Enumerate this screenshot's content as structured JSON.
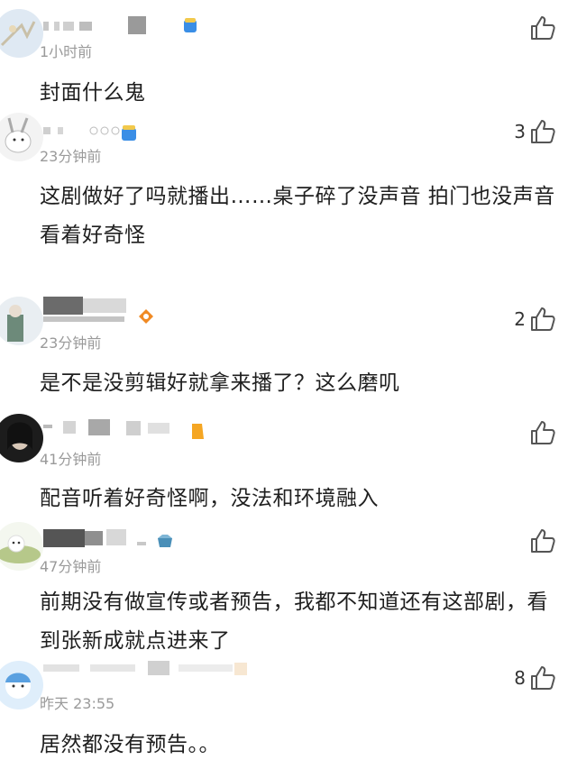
{
  "comments": [
    {
      "time": "1小时前",
      "text": "封面什么鬼",
      "likes": ""
    },
    {
      "time": "23分钟前",
      "text": "这剧做好了吗就播出……桌子碎了没声音 拍门也没声音 看着好奇怪",
      "likes": "3"
    },
    {
      "time": "23分钟前",
      "text": "是不是没剪辑好就拿来播了？这么磨叽",
      "likes": "2"
    },
    {
      "time": "41分钟前",
      "text": "配音听着好奇怪啊，没法和环境融入",
      "likes": ""
    },
    {
      "time": "47分钟前",
      "text": "前期没有做宣传或者预告，我都不知道还有这部剧，看到张新成就点进来了",
      "likes": ""
    },
    {
      "time": "昨天 23:55",
      "text": "居然都没有预告。。",
      "likes": "8"
    }
  ],
  "icons": {
    "like": "thumbs-up-icon"
  },
  "colors": {
    "text": "#1f1f1f",
    "meta": "#9a9a9a",
    "icon": "#555555"
  }
}
